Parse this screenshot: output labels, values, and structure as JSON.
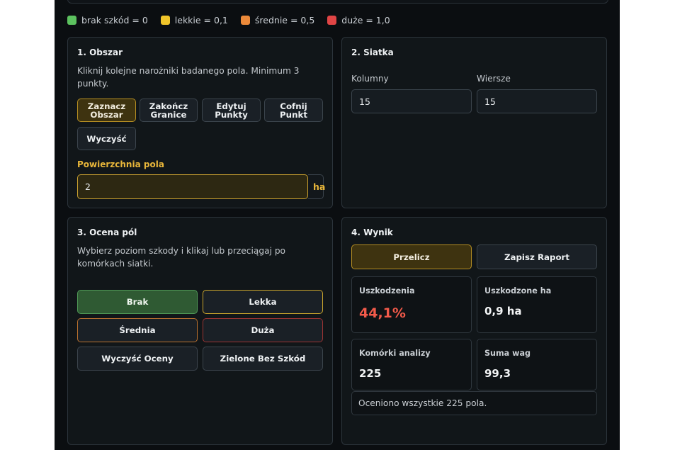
{
  "legend": [
    {
      "label": "brak szkód = 0",
      "color": "#5cc25f"
    },
    {
      "label": "lekkie = 0,1",
      "color": "#f0c52a"
    },
    {
      "label": "średnie = 0,5",
      "color": "#ec8a3a"
    },
    {
      "label": "duże = 1,0",
      "color": "#e04545"
    }
  ],
  "area": {
    "title": "1. Obszar",
    "description": "Kliknij kolejne narożniki badanego pola. Minimum 3 punkty.",
    "buttons": {
      "mark": "Zaznacz Obszar",
      "finish": "Zakończ Granice",
      "edit": "Edytuj Punkty",
      "undo": "Cofnij Punkt",
      "clear": "Wyczyść"
    },
    "field_label": "Powierzchnia pola",
    "field_value": "2",
    "unit": "ha"
  },
  "grid": {
    "title": "2. Siatka",
    "columns_label": "Kolumny",
    "columns_value": "15",
    "rows_label": "Wiersze",
    "rows_value": "15"
  },
  "rating": {
    "title": "3. Ocena pól",
    "description": "Wybierz poziom szkody i klikaj lub przeciągaj po komórkach siatki.",
    "buttons": {
      "none": "Brak",
      "light": "Lekka",
      "medium": "Średnia",
      "heavy": "Duża",
      "clear": "Wyczyść Oceny",
      "green": "Zielone Bez Szkód"
    }
  },
  "result": {
    "title": "4. Wynik",
    "recalc": "Przelicz",
    "save": "Zapisz Raport",
    "cards": {
      "damage_label": "Uszkodzenia",
      "damage_value": "44,1%",
      "damaged_ha_label": "Uszkodzone ha",
      "damaged_ha_value": "0,9 ha",
      "cells_label": "Komórki analizy",
      "cells_value": "225",
      "weights_label": "Suma wag",
      "weights_value": "99,3"
    },
    "status": "Oceniono wszystkie 225 pola."
  }
}
